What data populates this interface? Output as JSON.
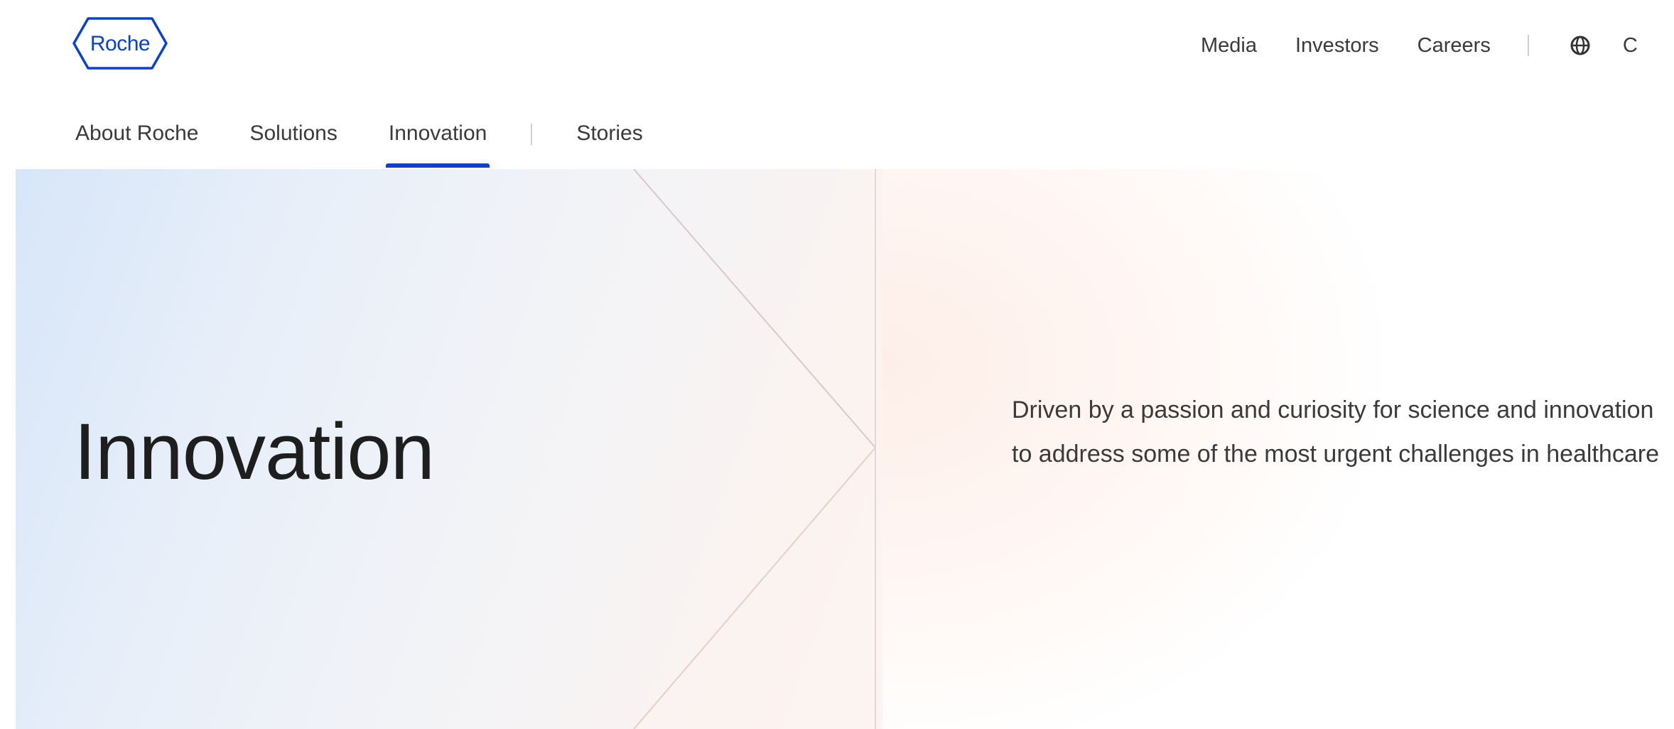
{
  "brand": {
    "logo_text": "Roche",
    "color": "#0b41cd"
  },
  "utility_nav": {
    "items": [
      {
        "label": "Media"
      },
      {
        "label": "Investors"
      },
      {
        "label": "Careers"
      }
    ],
    "globe_icon": "globe-icon",
    "cut_text": "C"
  },
  "main_nav": {
    "items": [
      {
        "label": "About Roche"
      },
      {
        "label": "Solutions"
      },
      {
        "label": "Innovation",
        "active": true
      },
      {
        "label": "Stories"
      }
    ]
  },
  "hero": {
    "title": "Innovation",
    "description": "Driven by a passion and curiosity for science and innovation to address some of the most urgent challenges in healthcare"
  }
}
